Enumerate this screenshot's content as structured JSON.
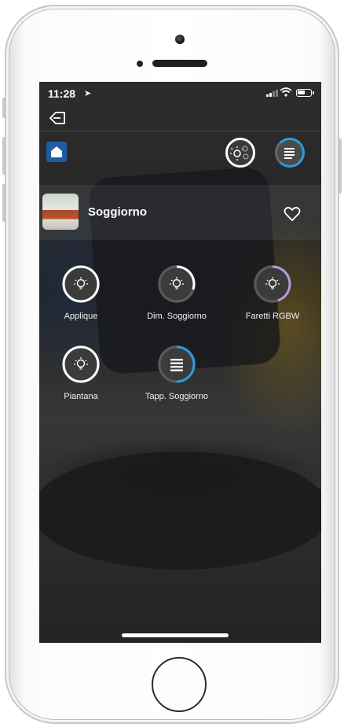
{
  "status_bar": {
    "time": "11:28"
  },
  "room": {
    "name": "Soggiorno"
  },
  "scenes": [
    {
      "icon": "lights-scene-icon"
    },
    {
      "icon": "shutters-scene-icon"
    }
  ],
  "devices": [
    {
      "label": "Applique",
      "icon": "bulb-icon",
      "ring_color": "#ffffff",
      "level": 1.0
    },
    {
      "label": "Dim. Soggiorno",
      "icon": "bulb-icon",
      "ring_color": "#ffffff",
      "level": 0.3
    },
    {
      "label": "Faretti RGBW",
      "icon": "bulb-icon",
      "ring_color": "#b59cd6",
      "level": 0.45
    },
    {
      "label": "Piantana",
      "icon": "bulb-icon",
      "ring_color": "#ffffff",
      "level": 1.0
    },
    {
      "label": "Tapp. Soggiorno",
      "icon": "shutter-icon",
      "ring_color": "#2d9cdb",
      "level": 0.5
    }
  ],
  "colors": {
    "accent_blue": "#2d9cdb",
    "home_tile": "#1f5da3"
  }
}
